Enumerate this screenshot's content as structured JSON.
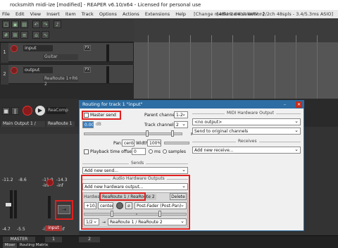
{
  "window": {
    "title": "rocksmith midi-ize [modified] - REAPER v6.10/x64 - Licensed for personal use"
  },
  "menu": {
    "items": [
      "File",
      "Edit",
      "View",
      "Insert",
      "Item",
      "Track",
      "Options",
      "Actions",
      "Extensions",
      "Help"
    ],
    "status": "[Change media item selection]",
    "audio_info": "[48kHz 64bit WAV : 2/2ch 48spls - 3.4/5.3ms ASIO]"
  },
  "tracks": [
    {
      "num": "1",
      "name": "input",
      "fx": "Guitar"
    },
    {
      "num": "2",
      "name": "output",
      "fx": "ReaRoute 1+R6 2"
    }
  ],
  "transport": {
    "plugin": "ReaComp",
    "master_output": "Main Output 1 / Mon",
    "route_short": "ReaRoute 1 /"
  },
  "mixer": {
    "vals": [
      "-11.2",
      "-8.6",
      "-11.0",
      "-14.3",
      "-inf",
      "-inf"
    ],
    "meter_bottom": [
      "-4.7",
      "-5.5",
      "-inf",
      "-inf"
    ],
    "strip_labels": [
      "MASTER",
      "input",
      "output"
    ],
    "strip_nums": [
      "1",
      "2"
    ],
    "bottom_tab": "Routing Matrix",
    "mixer_tab": "Mixer"
  },
  "dialog": {
    "title": "Routing for track 1 \"input\"",
    "master_send_label": "Master send",
    "parent_channels_label": "Parent channels:",
    "parent_channels_value": "1-2",
    "track_channels_label": "Track channels:",
    "track_channels_value": "2",
    "vol_value": "0.00",
    "pan_label": "Pan:",
    "pan_value": "center",
    "width_label": "Width:",
    "width_value": "100%",
    "playback_offset_label": "Playback time offset:",
    "playback_offset_value": "0",
    "ms_label": "ms",
    "samples_label": "samples",
    "sends_title": "Sends",
    "add_send": "Add new send...",
    "midi_hw_title": "MIDI Hardware Output",
    "midi_output_value": "<no output>",
    "midi_channels_value": "Send to original channels",
    "receives_title": "Receives",
    "add_receive": "Add new receive...",
    "audio_hw_title": "Audio Hardware Outputs",
    "add_hw_output": "Add new hardware output...",
    "hardware_label": "Hardware:",
    "hardware_value": "ReaRoute 1 / ReaRoute 2",
    "delete_label": "Delete",
    "hw_gain": "+10.1",
    "hw_pan": "center",
    "hw_mode": "Post-Fader (Post-Pan)",
    "hw_channels": "1/2",
    "hw_dest": "ReaRoute 1 / ReaRoute 2",
    "hw_dest_arrow": "→"
  }
}
